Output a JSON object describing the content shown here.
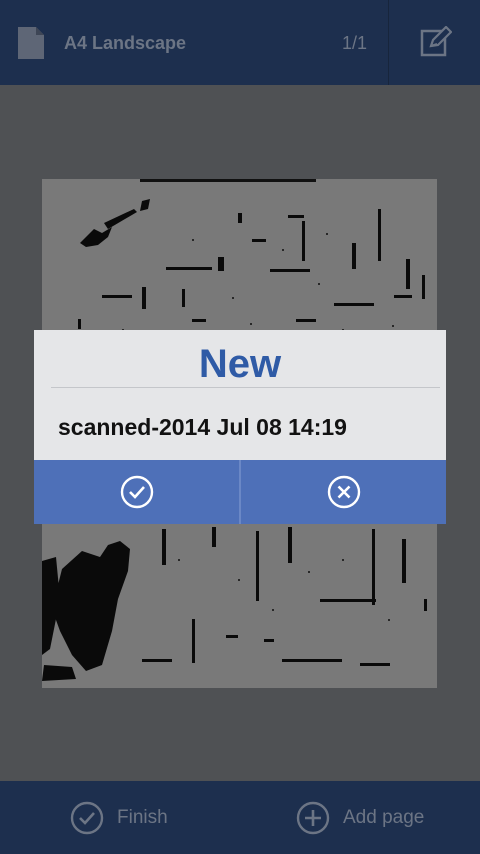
{
  "toolbar": {
    "page_format": "A4 Landscape",
    "page_counter": "1/1",
    "document_icon": "document-icon",
    "edit_icon": "edit-icon"
  },
  "dialog": {
    "title": "New",
    "filename": "scanned-2014 Jul 08 14:19",
    "confirm_icon": "check-circle-icon",
    "cancel_icon": "close-circle-icon"
  },
  "bottom_bar": {
    "finish_label": "Finish",
    "add_page_label": "Add page",
    "finish_icon": "check-circle-icon",
    "add_page_icon": "plus-circle-icon"
  },
  "colors": {
    "bar_background": "#1d2f4e",
    "dim_overlay": "#4f5154",
    "dialog_background": "#e5e6e8",
    "dialog_title": "#2f5ba6",
    "dialog_buttons": "#4e70b8"
  }
}
